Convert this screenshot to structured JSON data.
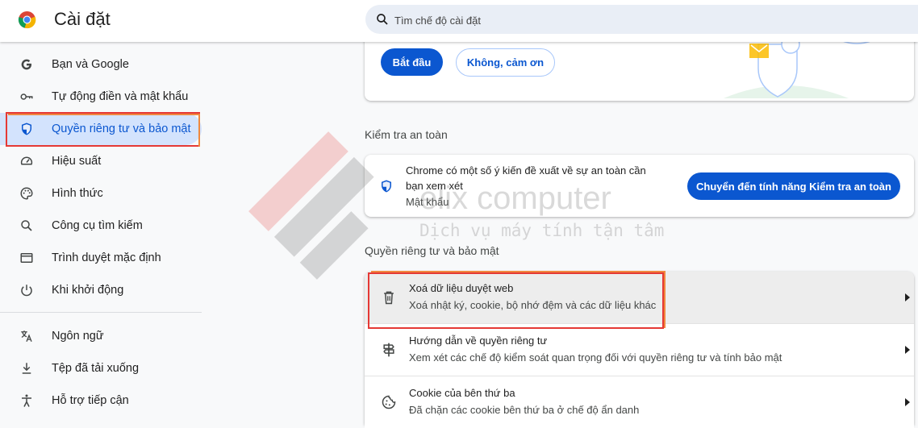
{
  "header": {
    "title": "Cài đặt",
    "search_placeholder": "Tìm chế độ cài đặt"
  },
  "sidebar": {
    "items": [
      {
        "label": "Bạn và Google",
        "icon": "google-icon"
      },
      {
        "label": "Tự động điền và mật khẩu",
        "icon": "key-icon"
      },
      {
        "label": "Quyền riêng tư và bảo mật",
        "icon": "shield-icon",
        "active": true
      },
      {
        "label": "Hiệu suất",
        "icon": "speedometer-icon"
      },
      {
        "label": "Hình thức",
        "icon": "palette-icon"
      },
      {
        "label": "Công cụ tìm kiếm",
        "icon": "search-icon"
      },
      {
        "label": "Trình duyệt mặc định",
        "icon": "browser-window-icon"
      },
      {
        "label": "Khi khởi động",
        "icon": "power-icon"
      },
      {
        "label": "Ngôn ngữ",
        "icon": "translate-icon"
      },
      {
        "label": "Tệp đã tải xuống",
        "icon": "download-icon"
      },
      {
        "label": "Hỗ trợ tiếp cận",
        "icon": "accessibility-icon"
      }
    ]
  },
  "promo": {
    "start_label": "Bắt đầu",
    "decline_label": "Không, cảm ơn"
  },
  "safety_check": {
    "section_title": "Kiểm tra an toàn",
    "line1": "Chrome có một số ý kiến đề xuất về sự an toàn cần",
    "line2": "bạn xem xét",
    "sub": "Mật khẩu",
    "button_label": "Chuyển đến tính năng Kiểm tra an toàn"
  },
  "privacy": {
    "section_title": "Quyền riêng tư và bảo mật",
    "rows": [
      {
        "title": "Xoá dữ liệu duyệt web",
        "desc": "Xoá nhật ký, cookie, bộ nhớ đệm và các dữ liệu khác",
        "icon": "trash-icon"
      },
      {
        "title": "Hướng dẫn về quyền riêng tư",
        "desc": "Xem xét các chế độ kiểm soát quan trọng đối với quyền riêng tư và tính bảo mật",
        "icon": "signpost-icon"
      },
      {
        "title": "Cookie của bên thứ ba",
        "desc": "Đã chặn các cookie bên thứ ba ở chế độ ẩn danh",
        "icon": "cookie-icon"
      }
    ]
  },
  "watermark": {
    "brand": "elix computer",
    "tagline": "Dịch vụ máy tính tận tâm"
  },
  "colors": {
    "accent": "#0b57d0",
    "active_bg": "#d3e3fd",
    "highlight_red": "#e53935",
    "highlight_orange": "#f0883e"
  }
}
